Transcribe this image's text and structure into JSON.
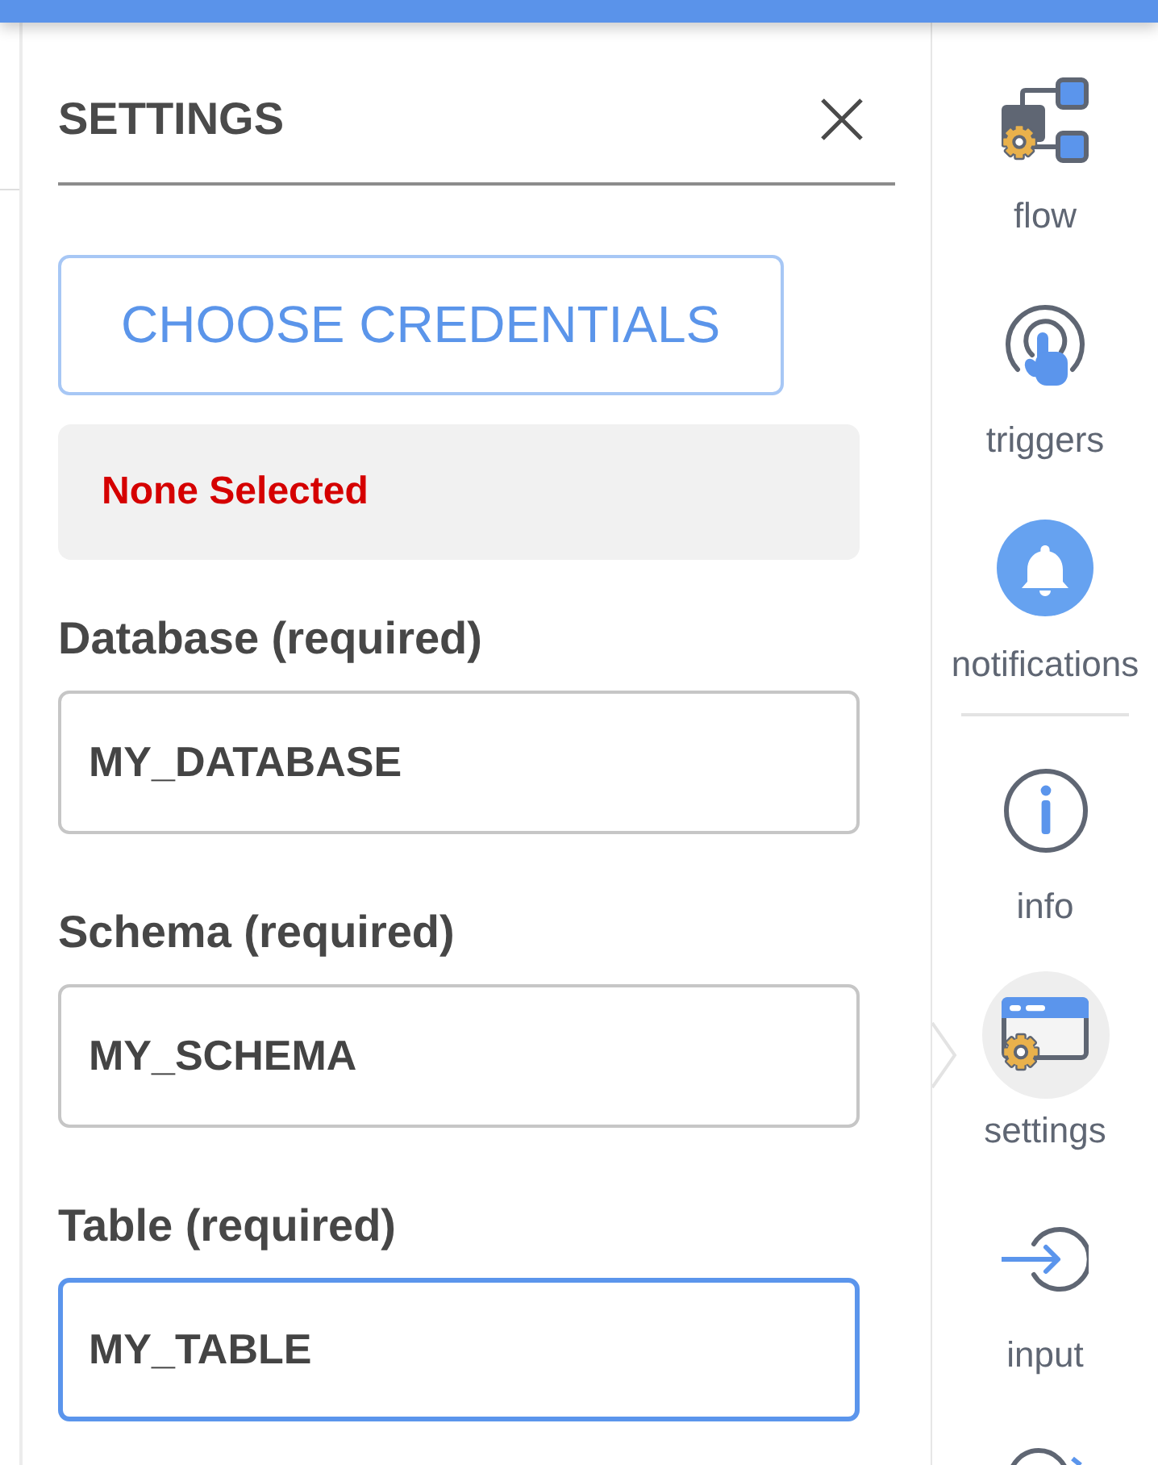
{
  "panel": {
    "title": "SETTINGS"
  },
  "credentials": {
    "button": "CHOOSE CREDENTIALS",
    "status": "None Selected"
  },
  "fields": [
    {
      "label": "Database (required)",
      "value": "MY_DATABASE",
      "focused": false
    },
    {
      "label": "Schema (required)",
      "value": "MY_SCHEMA",
      "focused": false
    },
    {
      "label": "Table (required)",
      "value": "MY_TABLE",
      "focused": true
    }
  ],
  "sidebar": {
    "groups": [
      {
        "items": [
          {
            "label": "flow",
            "selected": false
          },
          {
            "label": "triggers",
            "selected": false
          },
          {
            "label": "notifications",
            "selected": false
          }
        ]
      },
      {
        "items": [
          {
            "label": "info",
            "selected": false
          },
          {
            "label": "settings",
            "selected": true
          },
          {
            "label": "input",
            "selected": false
          }
        ]
      }
    ]
  }
}
